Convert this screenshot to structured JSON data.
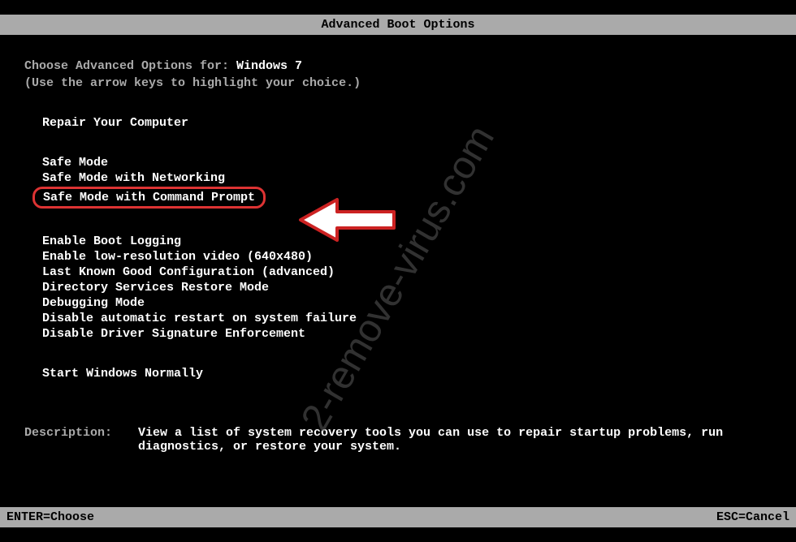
{
  "title": "Advanced Boot Options",
  "prompt": {
    "prefix": "Choose Advanced Options for: ",
    "os": "Windows 7",
    "hint": "(Use the arrow keys to highlight your choice.)"
  },
  "menu": {
    "top": "Repair Your Computer",
    "safe": [
      "Safe Mode",
      "Safe Mode with Networking",
      "Safe Mode with Command Prompt"
    ],
    "advanced": [
      "Enable Boot Logging",
      "Enable low-resolution video (640x480)",
      "Last Known Good Configuration (advanced)",
      "Directory Services Restore Mode",
      "Debugging Mode",
      "Disable automatic restart on system failure",
      "Disable Driver Signature Enforcement"
    ],
    "normal": "Start Windows Normally"
  },
  "description": {
    "label": "Description:",
    "text": "View a list of system recovery tools you can use to repair startup problems, run diagnostics, or restore your system."
  },
  "footer": {
    "enter": "ENTER=Choose",
    "esc": "ESC=Cancel"
  },
  "watermark": "2-remove-virus.com"
}
